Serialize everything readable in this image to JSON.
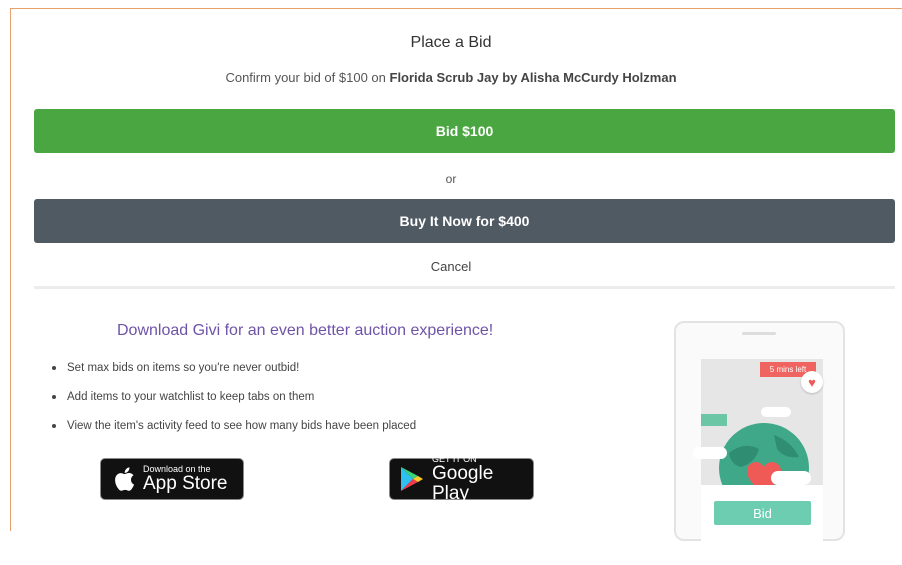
{
  "dialog": {
    "title": "Place a Bid",
    "confirm_prefix": "Confirm your bid of $100 on ",
    "item_name": "Florida Scrub Jay by Alisha McCurdy Holzman",
    "bid_button": "Bid $100",
    "or_text": "or",
    "buy_now_button": "Buy It Now for $400",
    "cancel": "Cancel"
  },
  "promo": {
    "title": "Download Givi for an even better auction experience!",
    "features": [
      "Set max bids on items so you're never outbid!",
      "Add items to your watchlist to keep tabs on them",
      "View the item's activity feed to see how many bids have been placed"
    ],
    "app_store": {
      "small": "Download on the",
      "big": "App Store"
    },
    "google_play": {
      "small": "GET IT ON",
      "big": "Google Play"
    }
  },
  "phone": {
    "badge": "5 mins left",
    "bid_button": "Bid"
  },
  "colors": {
    "bid_green": "#4aa640",
    "buy_gray": "#505a63",
    "promo_purple": "#6f53a8",
    "accent_teal": "#6ccdb0"
  }
}
